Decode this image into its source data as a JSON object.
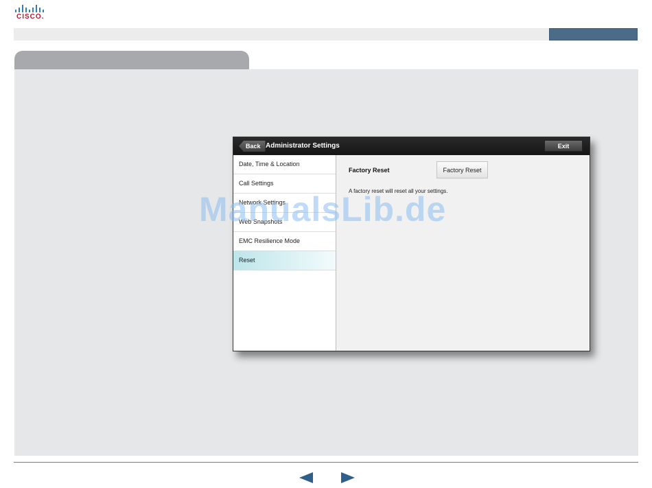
{
  "brand": {
    "logo_text": "CISCO.",
    "logo_color": "#c8102e"
  },
  "dialog": {
    "back_label": "Back",
    "title": "Administrator Settings",
    "exit_label": "Exit",
    "sidebar": {
      "items": [
        {
          "label": "Date, Time & Location",
          "active": false
        },
        {
          "label": "Call Settings",
          "active": false
        },
        {
          "label": "Network Settings",
          "active": false
        },
        {
          "label": "Web Snapshots",
          "active": false
        },
        {
          "label": "EMC Resilience Mode",
          "active": false
        },
        {
          "label": "Reset",
          "active": true
        }
      ]
    },
    "panel": {
      "heading": "Factory Reset",
      "button_label": "Factory Reset",
      "description": "A factory reset will reset all your settings."
    }
  },
  "watermark": "ManualsLib.de",
  "colors": {
    "accent": "#4c6b88",
    "nav_arrow": "#2f5f8a",
    "active_item": "#bde5ea"
  }
}
